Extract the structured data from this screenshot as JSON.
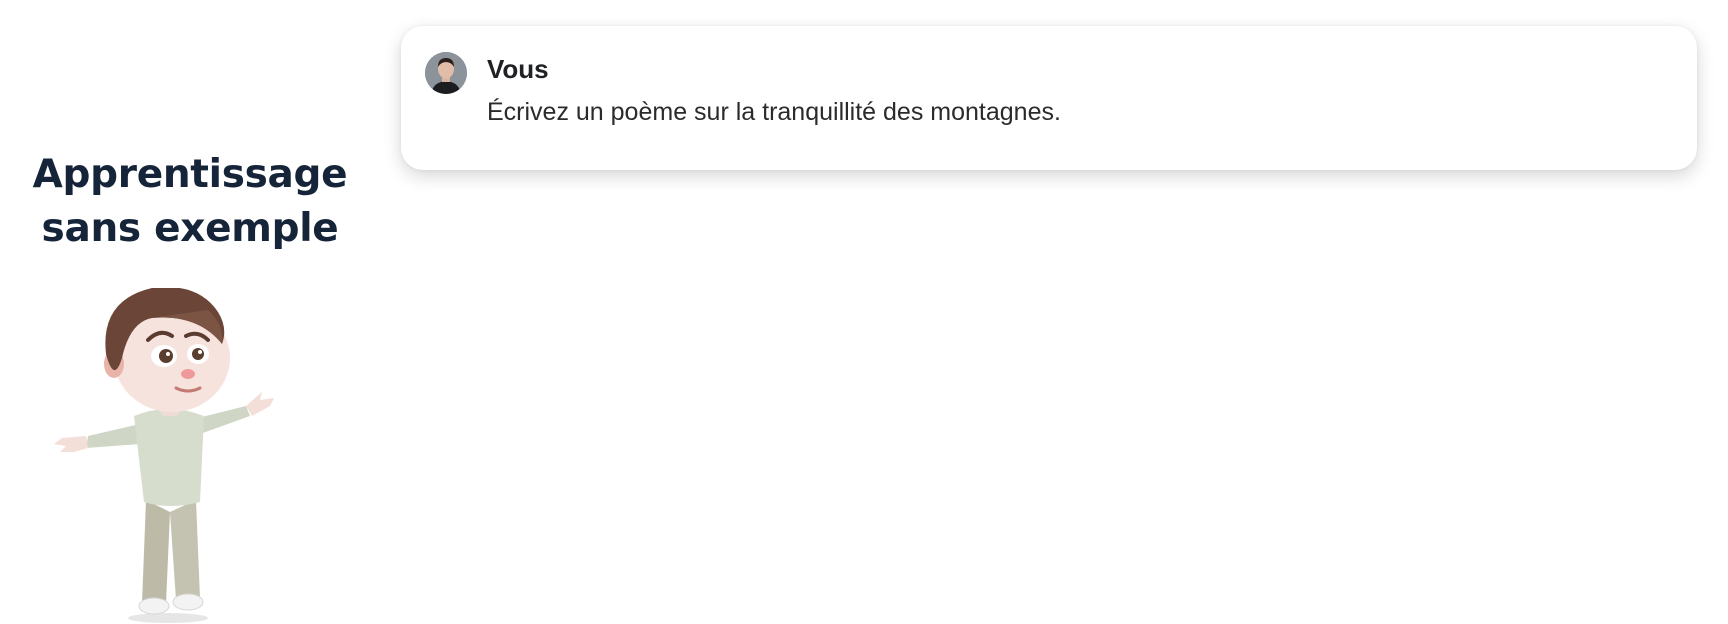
{
  "slide": {
    "heading_line1": "Apprentissage",
    "heading_line2": "sans exemple",
    "heading_color": "#16243a",
    "illustration": "cartoon-boy-shrugging"
  },
  "chat": {
    "sender": "Vous",
    "avatar_icon": "user-avatar-photo",
    "message": "Écrivez un poème sur la tranquillité des montagnes."
  }
}
